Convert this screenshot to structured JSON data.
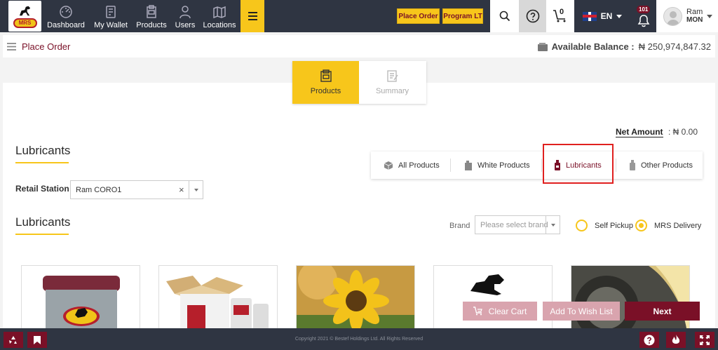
{
  "nav": {
    "items": [
      {
        "label": "Dashboard",
        "icon": "dashboard-icon"
      },
      {
        "label": "My Wallet",
        "icon": "wallet-icon"
      },
      {
        "label": "Products",
        "icon": "products-icon"
      },
      {
        "label": "Users",
        "icon": "users-icon"
      },
      {
        "label": "Locations",
        "icon": "locations-icon"
      }
    ],
    "place_order": "Place Order",
    "program_lt": "Program LT",
    "cart_count": "0",
    "language": "EN",
    "notification_count": "101",
    "user": {
      "name": "Ram",
      "org": "MON"
    },
    "logo_text": "MRS"
  },
  "breadcrumb": {
    "title": "Place Order"
  },
  "balance": {
    "label": "Available Balance :",
    "value": "₦ 250,974,847.32"
  },
  "tabs": [
    {
      "label": "Products",
      "active": true
    },
    {
      "label": "Summary",
      "active": false
    }
  ],
  "net_amount": {
    "label": "Net Amount",
    "value": ": ₦ 0.00"
  },
  "section": {
    "title": "Lubricants",
    "list_title": "Lubricants"
  },
  "filters": [
    {
      "label": "All Products",
      "icon": "box-icon"
    },
    {
      "label": "White Products",
      "icon": "jerrycan-icon"
    },
    {
      "label": "Lubricants",
      "icon": "oil-bottle-icon",
      "selected": true
    },
    {
      "label": "Other Products",
      "icon": "canister-icon"
    }
  ],
  "retail_station": {
    "label": "Retail Station",
    "value": "Ram CORO1",
    "clear": "×"
  },
  "brand": {
    "label": "Brand",
    "placeholder": "Please select brand"
  },
  "delivery": [
    {
      "label": "Self Pickup",
      "checked": false
    },
    {
      "label": "MRS Delivery",
      "checked": true
    }
  ],
  "actions": {
    "clear_cart": "Clear Cart",
    "wishlist": "Add To Wish List",
    "next": "Next"
  },
  "footer": {
    "copyright": "Copyright 2021 © Bestef Holdings Ltd. All Rights Reserved"
  },
  "colors": {
    "brand_yellow": "#f7c61b",
    "brand_maroon": "#7a1027",
    "nav_bg": "#2f3542",
    "highlight_red": "#e0201f"
  }
}
